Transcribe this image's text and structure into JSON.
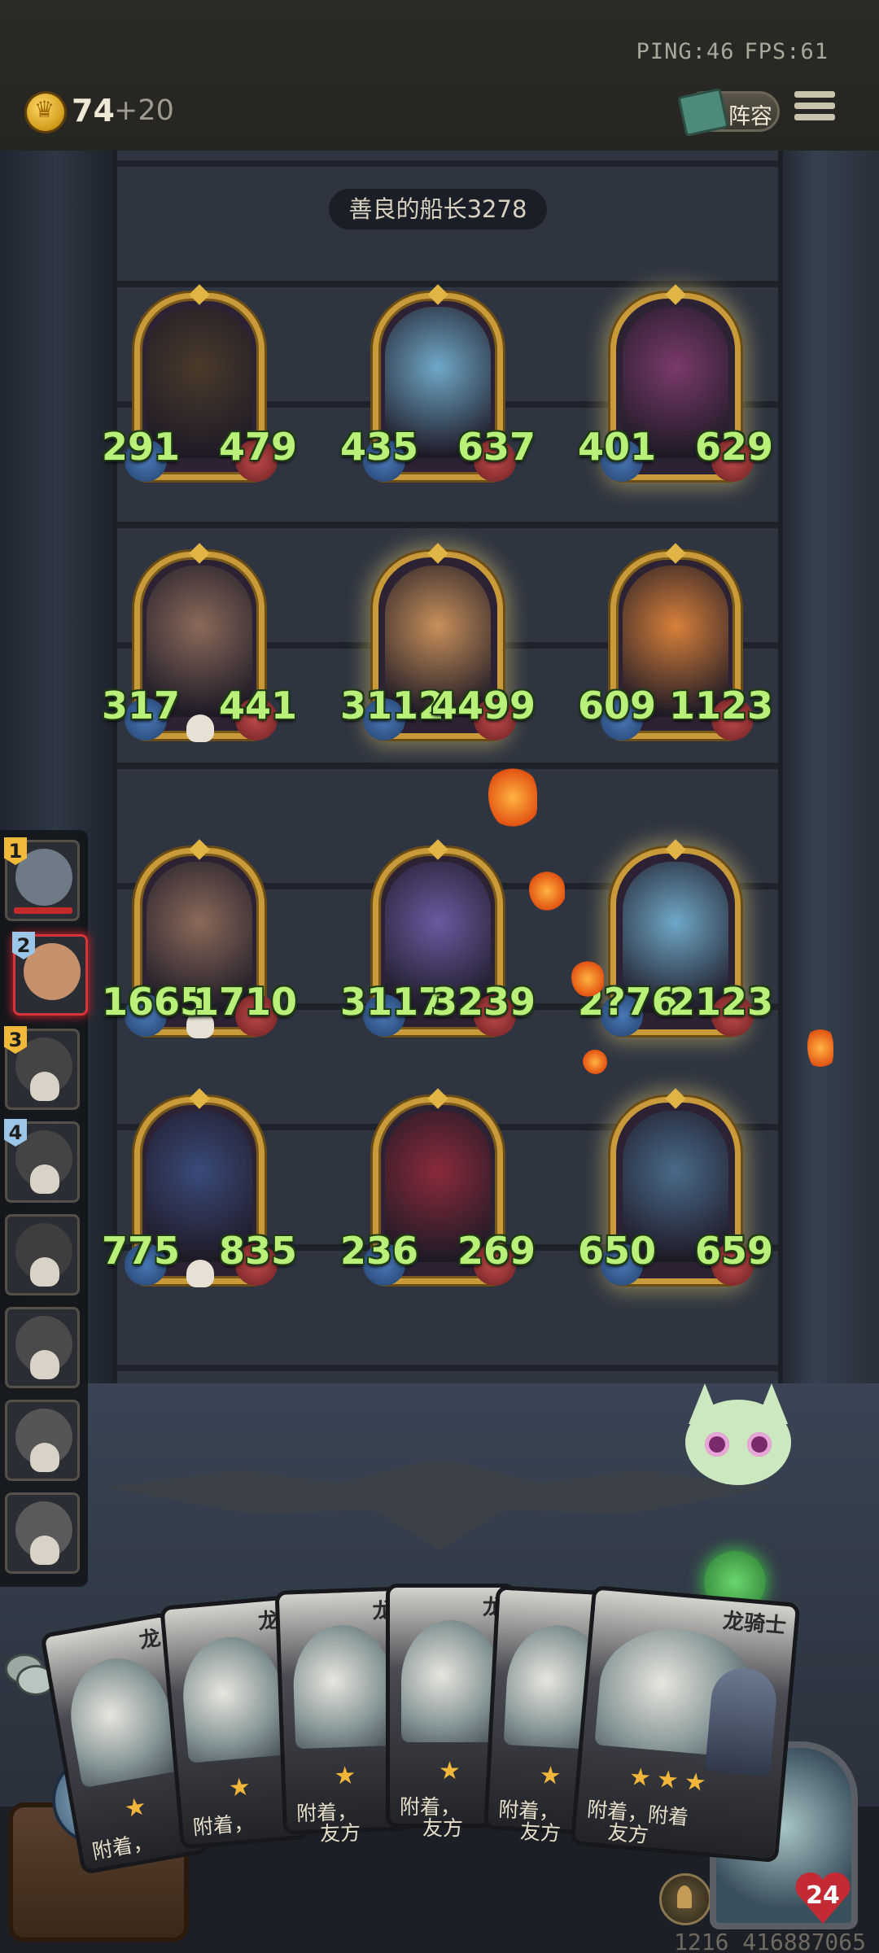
{
  "status": {
    "ping": "PING:46",
    "fps": "FPS:61"
  },
  "resources": {
    "gold": "74",
    "gold_income": "+20"
  },
  "header": {
    "lineup_label": "阵容"
  },
  "opponent": {
    "name": "善良的船长3278"
  },
  "board": {
    "units": [
      {
        "attack": "291",
        "health": "479"
      },
      {
        "attack": "435",
        "health": "637"
      },
      {
        "attack": "401",
        "health": "629"
      },
      {
        "attack": "317",
        "health": "441"
      },
      {
        "attack": "3112",
        "health": "4499"
      },
      {
        "attack": "609",
        "health": "1123"
      },
      {
        "attack": "1665",
        "health": "1710"
      },
      {
        "attack": "3117",
        "health": "3239"
      },
      {
        "attack": "2?76",
        "health": "2123"
      },
      {
        "attack": "775",
        "health": "835"
      },
      {
        "attack": "236",
        "health": "269"
      },
      {
        "attack": "650",
        "health": "659"
      }
    ]
  },
  "players": {
    "slots": [
      {
        "rank": "1"
      },
      {
        "rank": "2"
      },
      {
        "rank": "3"
      },
      {
        "rank": "4"
      }
    ]
  },
  "hand": {
    "cards": [
      {
        "name": "龙",
        "desc1": "附着，",
        "desc2": ""
      },
      {
        "name": "龙",
        "desc1": "附着，",
        "desc2": ""
      },
      {
        "name": "龙",
        "desc1": "附着，",
        "desc2": "友方"
      },
      {
        "name": "龙",
        "desc1": "附着，",
        "desc2": "友方"
      },
      {
        "name": "龙",
        "desc1": "附着，",
        "desc2": "友方"
      },
      {
        "name": "龙骑士",
        "desc1": "附着，附着",
        "desc2": "友方"
      }
    ]
  },
  "hero": {
    "health": "24"
  },
  "footer": {
    "id": "1216 416887065"
  }
}
